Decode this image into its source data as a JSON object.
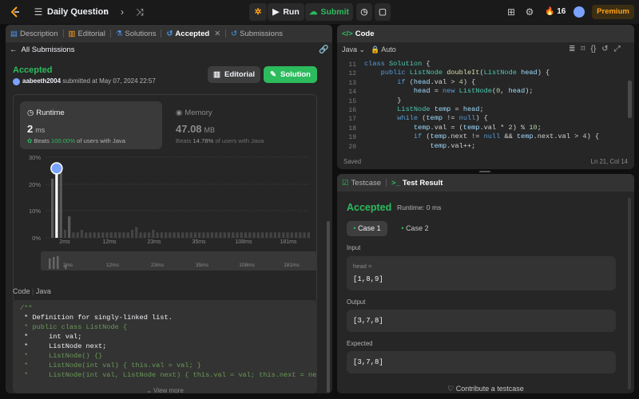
{
  "topbar": {
    "title": "Daily Question",
    "run": "Run",
    "submit": "Submit",
    "streak": "16",
    "premium": "Premium"
  },
  "lefttabs": {
    "description": "Description",
    "editorial": "Editorial",
    "solutions": "Solutions",
    "accepted": "Accepted",
    "submissions": "Submissions"
  },
  "sub": {
    "back": "All Submissions",
    "status": "Accepted",
    "user": "aabeeth2004",
    "submitted": "submitted at May 07, 2024 22:57",
    "editorial_btn": "Editorial",
    "solution_btn": "Solution"
  },
  "runtime": {
    "label": "Runtime",
    "value": "2",
    "unit": "ms",
    "beats_pre": "Beats",
    "beats_pct": "100.00%",
    "beats_post": "of users with Java"
  },
  "memory": {
    "label": "Memory",
    "value": "47.08",
    "unit": "MB",
    "beats_pre": "Beats",
    "beats_pct": "14.78%",
    "beats_post": "of users with Java"
  },
  "chart_data": {
    "type": "bar",
    "categories": [
      "2ms",
      "12ms",
      "23ms",
      "35ms",
      "108ms",
      "181ms"
    ],
    "ylabels": [
      "30%",
      "20%",
      "10%",
      "0%"
    ],
    "ylim": [
      0,
      30
    ],
    "highlight_index": 1,
    "values": [
      22,
      25,
      27,
      3,
      8,
      2,
      2,
      3,
      2,
      2,
      2,
      2,
      2,
      2,
      2,
      2,
      2,
      2,
      2,
      3,
      4,
      2,
      2,
      2,
      3,
      2,
      2,
      2,
      2,
      2,
      2,
      2,
      2,
      2,
      2,
      2,
      2,
      2,
      2,
      2,
      2,
      2,
      2,
      2,
      2,
      2,
      2,
      2,
      2,
      2,
      2,
      2,
      2,
      2,
      2,
      2,
      2,
      2,
      2,
      2,
      2,
      2
    ]
  },
  "minimap": {
    "labels": [
      "2ms",
      "12ms",
      "23ms",
      "35ms",
      "108ms",
      "181ms"
    ]
  },
  "codesec": {
    "label": "Code",
    "lang": "Java",
    "viewmore": "View more",
    "lines": [
      "/**",
      " * Definition for singly-linked list.",
      " * public class ListNode {",
      " *     int val;",
      " *     ListNode next;",
      " *     ListNode() {}",
      " *     ListNode(int val) { this.val = val; }",
      " *     ListNode(int val, ListNode next) { this.val = val; this.next = next"
    ]
  },
  "editor": {
    "title": "Code",
    "lang": "Java",
    "auto": "Auto",
    "saved": "Saved",
    "pos": "Ln 21, Col 14",
    "lines": [
      {
        "n": "11",
        "t": "class Solution {"
      },
      {
        "n": "12",
        "t": "    public ListNode doubleIt(ListNode head) {"
      },
      {
        "n": "13",
        "t": "        if (head.val > 4) {"
      },
      {
        "n": "14",
        "t": "            head = new ListNode(0, head);"
      },
      {
        "n": "15",
        "t": "        }"
      },
      {
        "n": "16",
        "t": "        ListNode temp = head;"
      },
      {
        "n": "17",
        "t": "        while (temp != null) {"
      },
      {
        "n": "18",
        "t": "            temp.val = (temp.val * 2) % 10;"
      },
      {
        "n": "19",
        "t": "            if (temp.next != null && temp.next.val > 4) {"
      },
      {
        "n": "20",
        "t": "                temp.val++;"
      }
    ]
  },
  "result": {
    "testcase_tab": "Testcase",
    "result_tab": "Test Result",
    "status": "Accepted",
    "runtime": "Runtime: 0 ms",
    "case1": "Case 1",
    "case2": "Case 2",
    "input_label": "Input",
    "input_var": "head =",
    "input_val": "[1,8,9]",
    "output_label": "Output",
    "output_val": "[3,7,8]",
    "expected_label": "Expected",
    "expected_val": "[3,7,8]",
    "contribute": "Contribute a testcase"
  }
}
